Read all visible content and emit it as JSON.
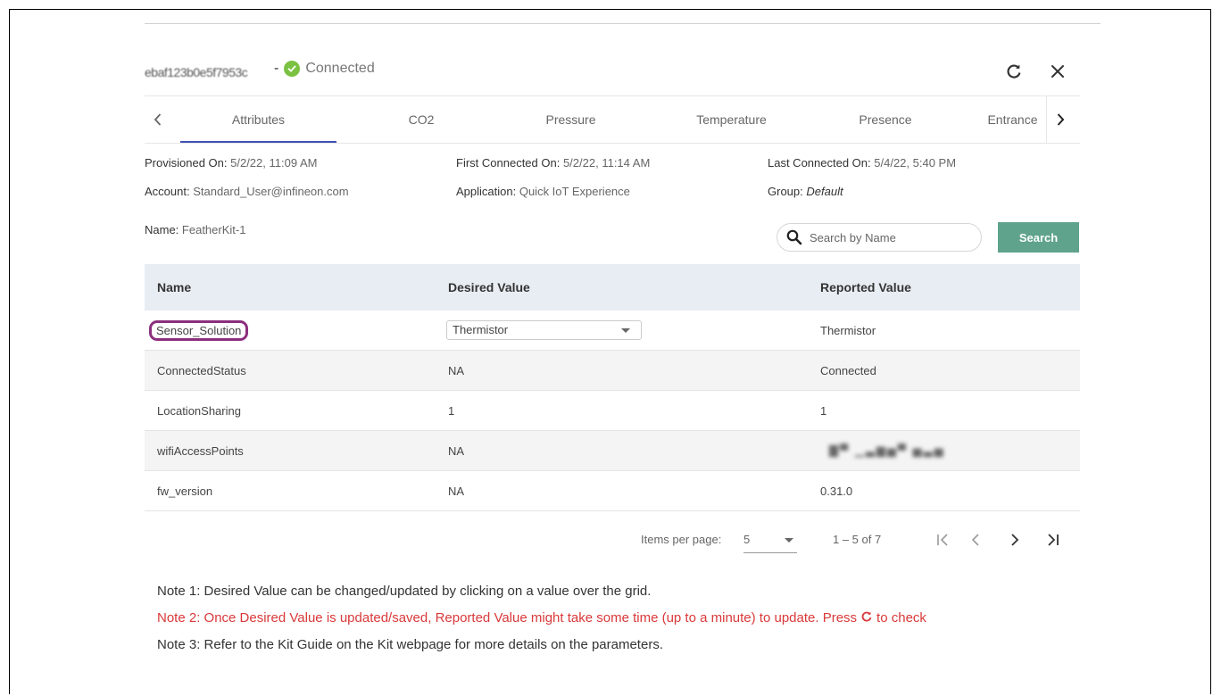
{
  "header": {
    "device_id": "ebaf123b0e5f7953c",
    "status_separator": "-",
    "status_text": "Connected"
  },
  "tabs": [
    "Attributes",
    "CO2",
    "Pressure",
    "Temperature",
    "Presence",
    "Entrance"
  ],
  "active_tab": "Attributes",
  "info": {
    "provisioned_label": "Provisioned On:",
    "provisioned_value": "5/2/22, 11:09 AM",
    "first_connected_label": "First Connected On:",
    "first_connected_value": "5/2/22, 11:14 AM",
    "last_connected_label": "Last Connected On:",
    "last_connected_value": "5/4/22, 5:40 PM",
    "account_label": "Account:",
    "account_value": "Standard_User@infineon.com",
    "application_label": "Application:",
    "application_value": "Quick IoT Experience",
    "group_label": "Group:",
    "group_value": "Default",
    "name_label": "Name:",
    "name_value": "FeatherKit-1"
  },
  "search": {
    "placeholder": "Search by Name",
    "button_label": "Search"
  },
  "table": {
    "headers": [
      "Name",
      "Desired Value",
      "Reported Value"
    ],
    "rows": [
      {
        "name": "Sensor_Solution",
        "desired": "Thermistor",
        "reported": "Thermistor"
      },
      {
        "name": "ConnectedStatus",
        "desired": "NA",
        "reported": "Connected"
      },
      {
        "name": "LocationSharing",
        "desired": "1",
        "reported": "1"
      },
      {
        "name": "wifiAccessPoints",
        "desired": "NA",
        "reported": "blurred"
      },
      {
        "name": "fw_version",
        "desired": "NA",
        "reported": "0.31.0"
      }
    ]
  },
  "paginator": {
    "items_per_page_label": "Items per page:",
    "page_size": "5",
    "range_label": "1 – 5 of 7"
  },
  "notes": {
    "note1": "Note 1: Desired Value can be changed/updated by clicking on a value over the grid.",
    "note2_before": "Note 2: Once Desired Value is updated/saved, Reported Value might take some time (up to a minute) to update. Press",
    "note2_after": "to check",
    "note3": "Note 3: Refer to the Kit Guide on the Kit webpage for more details on the parameters."
  },
  "colors": {
    "accent_tab": "#3f51b5",
    "search_button": "#5fa38d",
    "status_green": "#7bc142",
    "note_red": "#d9393a",
    "highlight_purple": "#8c2f7e"
  },
  "icons": [
    "check-icon",
    "refresh-icon",
    "close-icon",
    "chevron-left-icon",
    "chevron-right-icon",
    "search-icon",
    "first-page-icon",
    "last-page-icon"
  ]
}
